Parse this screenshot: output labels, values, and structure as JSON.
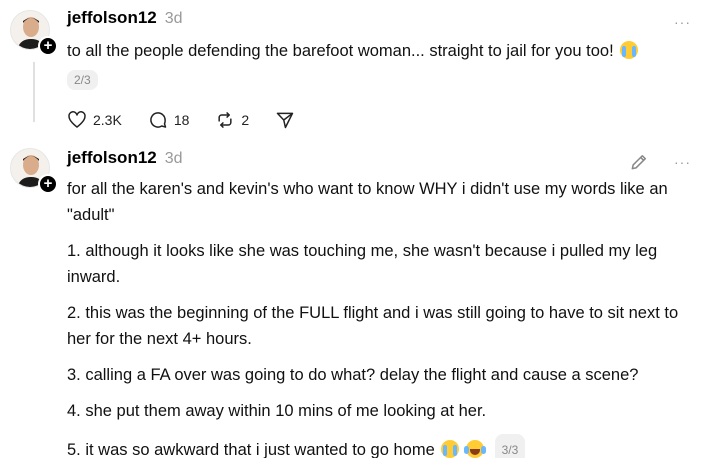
{
  "posts": [
    {
      "username": "jeffolson12",
      "time": "3d",
      "more": "···",
      "text": "to all the people defending the barefoot woman... straight to jail for you too!",
      "page": "2/3",
      "actions": {
        "likes": "2.3K",
        "replies": "18",
        "reposts": "2"
      },
      "icons": [
        "avatar",
        "follow-plus-icon",
        "crying-emoji",
        "heart-icon",
        "comment-icon",
        "repost-icon",
        "share-icon",
        "more-icon"
      ]
    },
    {
      "username": "jeffolson12",
      "time": "3d",
      "more": "···",
      "paragraphs": [
        "for all the karen's and kevin's who want to know WHY i didn't use my words like an \"adult\"",
        "1. although it looks like she was touching me, she wasn't because i pulled my leg inward.",
        "2. this was the beginning of the FULL flight and i was still going to have to sit next to her for the next 4+ hours.",
        "3. calling a FA over was going to do what? delay the flight and cause a scene?",
        "4. she put them away within 10 mins of me looking at her.",
        "5. it was so awkward that i just wanted to go home"
      ],
      "page": "3/3",
      "icons": [
        "avatar",
        "follow-plus-icon",
        "edit-icon",
        "more-icon",
        "crying-emoji",
        "laughing-emoji"
      ]
    }
  ]
}
